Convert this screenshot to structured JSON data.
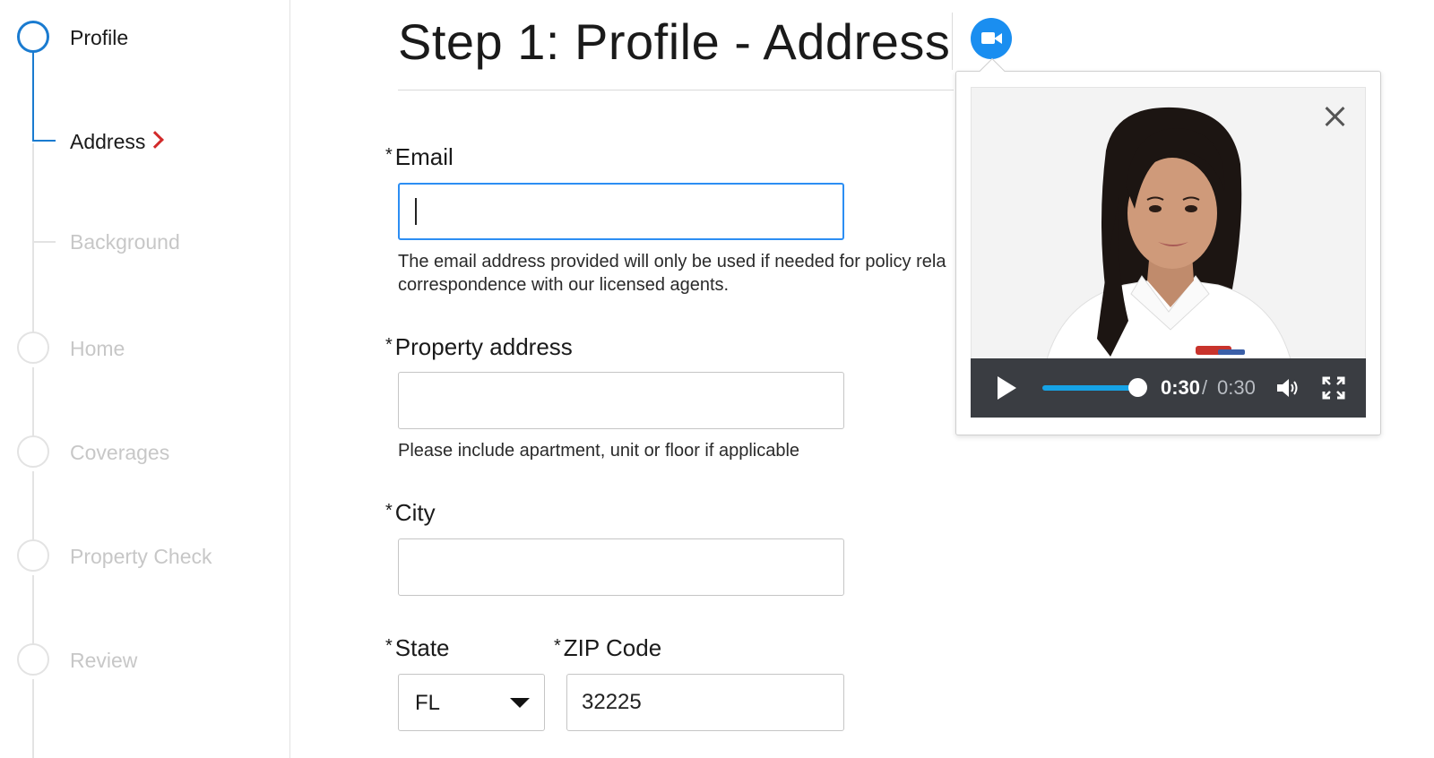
{
  "sidebar": {
    "steps": [
      {
        "label": "Profile",
        "state": "active"
      },
      {
        "label": "Address",
        "state": "current-substep"
      },
      {
        "label": "Background",
        "state": "upcoming-substep"
      },
      {
        "label": "Home",
        "state": "upcoming"
      },
      {
        "label": "Coverages",
        "state": "upcoming"
      },
      {
        "label": "Property Check",
        "state": "upcoming"
      },
      {
        "label": "Review",
        "state": "upcoming"
      }
    ]
  },
  "page": {
    "title": "Step 1: Profile - Address"
  },
  "form": {
    "required_marker": "*",
    "email": {
      "label": "Email",
      "value": "",
      "help": "The email address provided will only be used if needed for policy rela",
      "help2": "correspondence with our licensed agents."
    },
    "property_address": {
      "label": "Property address",
      "value": "",
      "help": "Please include apartment, unit or floor if applicable"
    },
    "city": {
      "label": "City",
      "value": ""
    },
    "state": {
      "label": "State",
      "value": "FL"
    },
    "zip": {
      "label": "ZIP Code",
      "value": "32225"
    }
  },
  "video": {
    "current_time": "0:30",
    "separator": "/",
    "total_time": "0:30",
    "progress": 1.0
  },
  "colors": {
    "accent_blue": "#1a7bd0",
    "video_button": "#1a8ef0",
    "chevron_red": "#d22a2a",
    "progress": "#16a3e6",
    "controls_bg": "#3a3d42"
  }
}
